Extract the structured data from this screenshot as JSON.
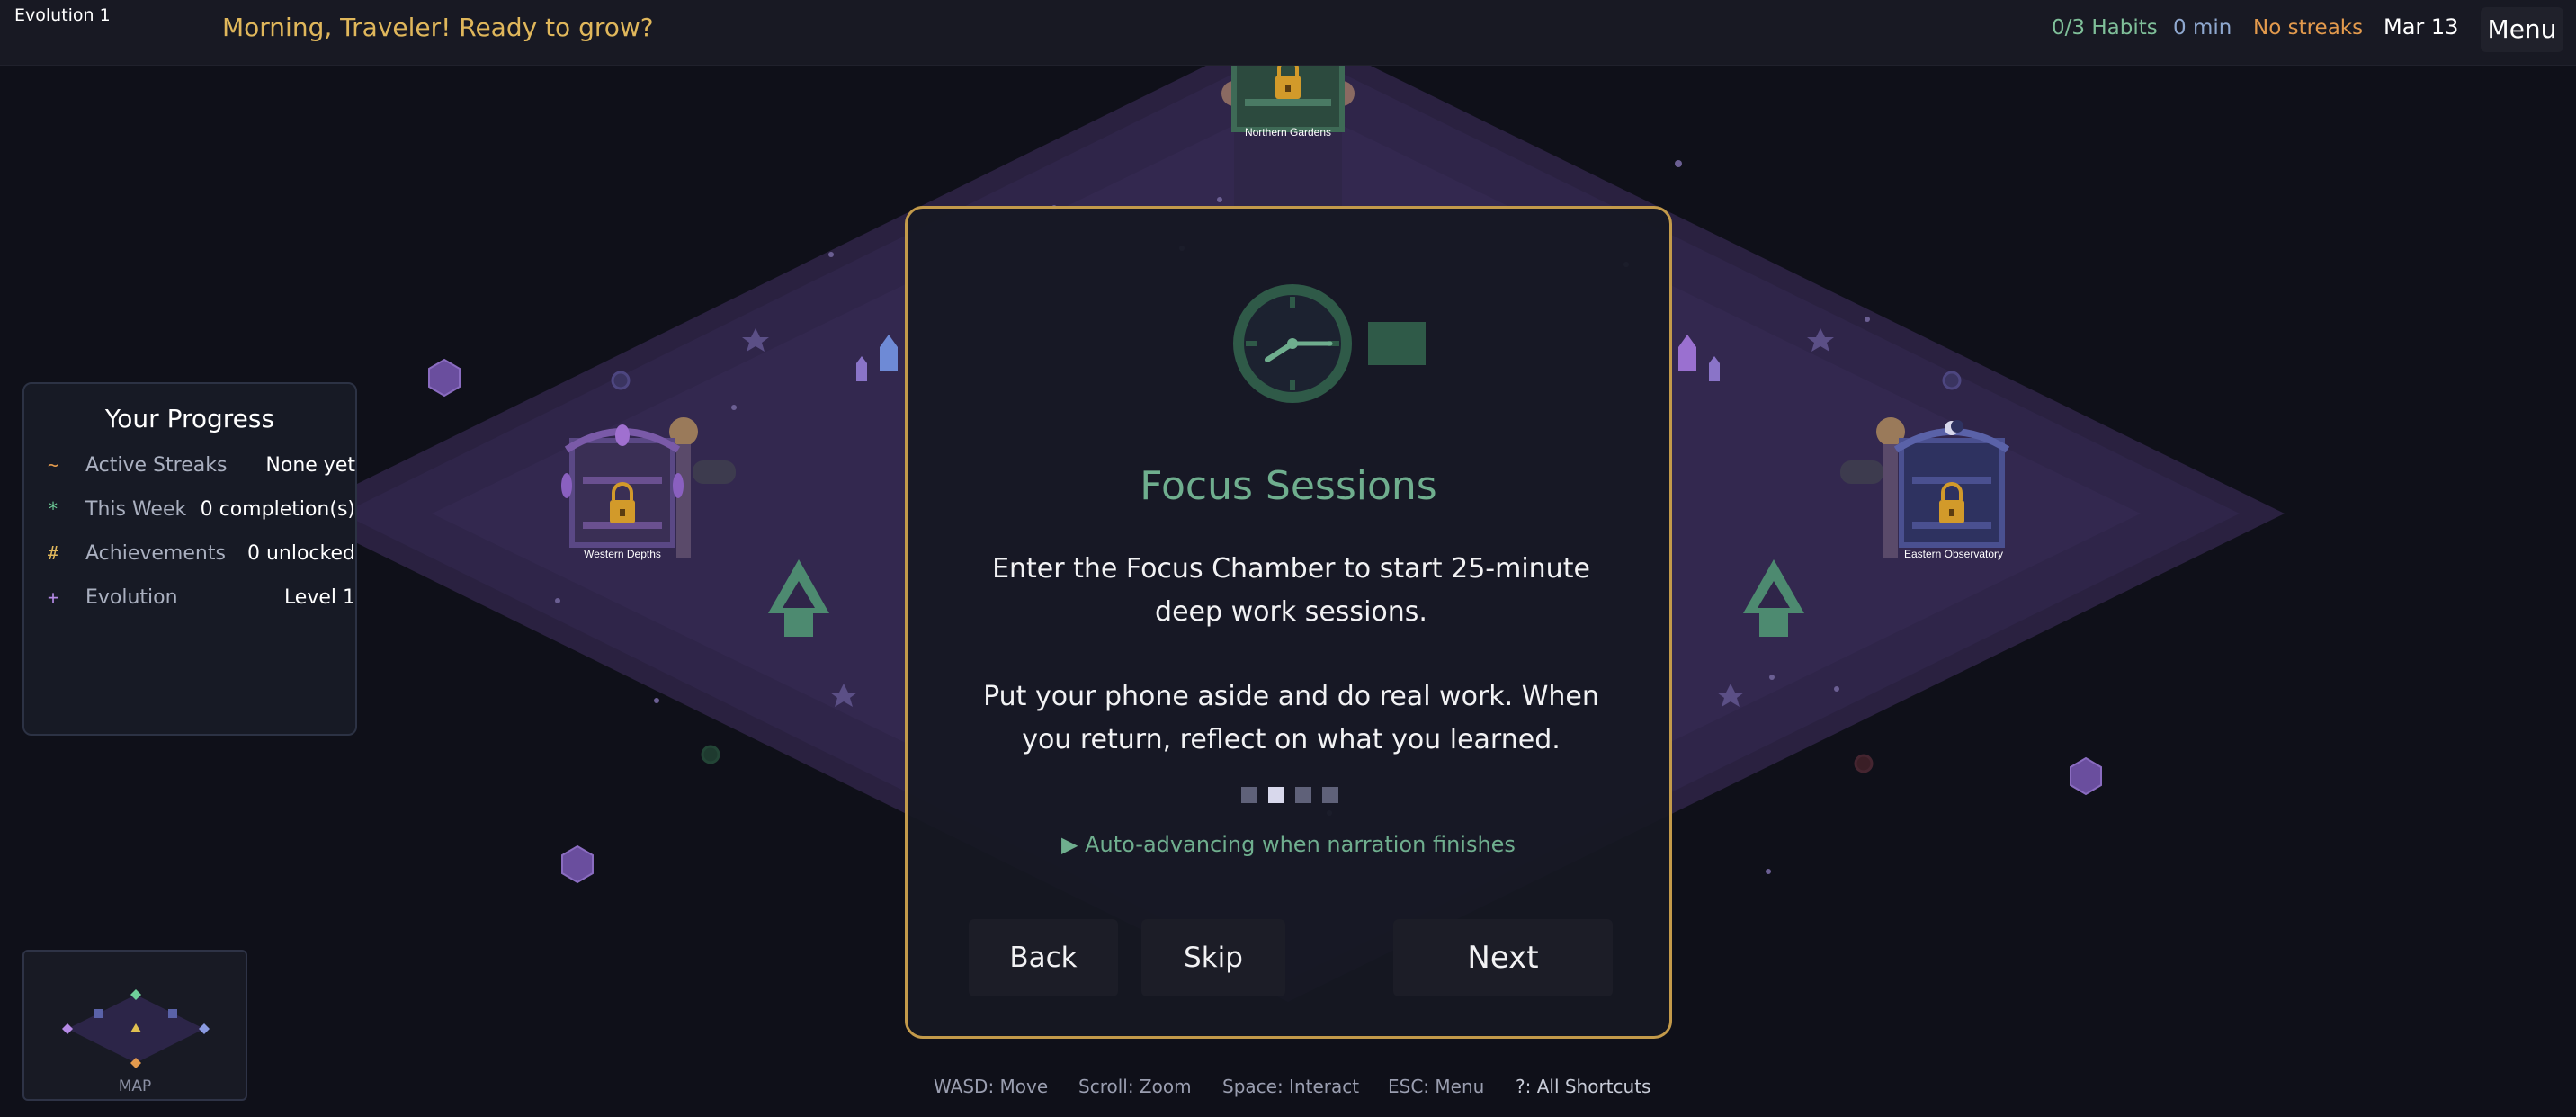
{
  "hud": {
    "evolution_label": "Evolution 1",
    "greeting": "Morning, Traveler! Ready to grow?",
    "habits": "0/3 Habits",
    "minutes": "0 min",
    "streaks": "No streaks",
    "date": "Mar 13",
    "menu_label": "Menu"
  },
  "map": {
    "locations": {
      "north": "Northern Gardens",
      "west": "Western Depths",
      "east": "Eastern Observatory"
    }
  },
  "progress": {
    "title": "Your Progress",
    "rows": [
      {
        "symbol": "~",
        "label": "Active Streaks",
        "value": "None yet",
        "color": "#e39a4d"
      },
      {
        "symbol": "*",
        "label": "This Week",
        "value": "0 completion(s)",
        "color": "#6fcf9a"
      },
      {
        "symbol": "#",
        "label": "Achievements",
        "value": "0 unlocked",
        "color": "#e0b75b"
      },
      {
        "symbol": "+",
        "label": "Evolution",
        "value": "Level 1",
        "color": "#b58ae6"
      }
    ]
  },
  "minimap": {
    "label": "MAP"
  },
  "tutorial": {
    "title": "Focus Sessions",
    "body_1": "Enter the Focus Chamber to start 25-minute deep work sessions.",
    "body_2": "Put your phone aside and do real work. When you return, reflect on what you learned.",
    "step_current": 2,
    "step_total": 4,
    "auto_note": "▶ Auto-advancing when narration finishes",
    "back_label": "Back",
    "skip_label": "Skip",
    "next_label": "Next"
  },
  "hints": {
    "move": "WASD: Move",
    "zoom": "Scroll: Zoom",
    "interact": "Space: Interact",
    "menu": "ESC: Menu",
    "shortcuts": "?: All Shortcuts"
  },
  "colors": {
    "accent_gold": "#c39a4a",
    "accent_green": "#6fae8e",
    "background": "#0f1019"
  }
}
